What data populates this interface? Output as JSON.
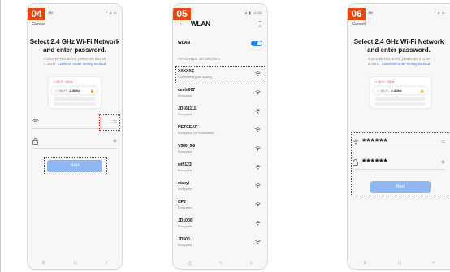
{
  "step1": {
    "badge": "04",
    "status_left": "AM",
    "status_right": "* ⊿ ▭",
    "cancel": "Cancel",
    "title_line1": "Select 2.4 GHz Wi-Fi Network",
    "title_line2": "and enter password.",
    "sub_line1": "If your Wi-Fi is 5GHz, please set it to be",
    "sub_prefix": "2.4GHz.",
    "sub_link": "Common router setting method",
    "card_row1": "× Wi-Fi - 5Ghz",
    "card_row2_prefix": "✓ Wi-Fi - ",
    "card_row2_bold": "2.4Ghz",
    "password_value": "",
    "next": "Next"
  },
  "step2": {
    "badge": "05",
    "status_right": "⊿ ▮ 11:02",
    "back": "←",
    "title": "WLAN",
    "more": "⋮",
    "toggle_label": "WLAN",
    "toggle_on": true,
    "available": "AVAILABLE NETWORKS",
    "networks": [
      {
        "name": "XXXXXX",
        "status": "Connected (good quality)"
      },
      {
        "name": "ceshi007",
        "status": "Encrypted"
      },
      {
        "name": "JD161111",
        "status": "Encrypted"
      },
      {
        "name": "NETGEAR",
        "status": "Encrypted (WPS available)"
      },
      {
        "name": "V380_5G",
        "status": "Encrypted"
      },
      {
        "name": "wifi123",
        "status": "Encrypted"
      },
      {
        "name": "xiaoyi",
        "status": "Encrypted"
      },
      {
        "name": "CP2",
        "status": "Encrypted"
      },
      {
        "name": "JD1000",
        "status": "Encrypted"
      },
      {
        "name": "JD500",
        "status": "Encrypted"
      }
    ]
  },
  "step3": {
    "badge": "06",
    "status_left": "AM",
    "status_right": "* ⊿ ▭",
    "cancel": "Cancel",
    "title_line1": "Select 2.4 GHz Wi-Fi Network",
    "title_line2": "and enter password.",
    "sub_line1": "If your Wi-Fi is 5GHz, please set it to be",
    "sub_prefix": "2.4GHz.",
    "sub_link": "Common router setting method",
    "card_row1": "× Wi-Fi - 5Ghz",
    "card_row2_prefix": "✓ Wi-Fi - ",
    "card_row2_bold": "2.4Ghz",
    "ssid_value": "******",
    "password_value": "******",
    "next": "Next"
  },
  "nav": {
    "menu": "≡",
    "home": "□",
    "back": "‹",
    "back2": "◁",
    "home2": "○"
  },
  "icons": {
    "wifi": "wifi-icon",
    "lock": "lock-icon",
    "eye": "eye-icon",
    "swap": "swap-icon",
    "signal": "wifi-signal-icon"
  },
  "colors": {
    "badge": "#e8460e",
    "accent": "#2f80ed",
    "highlight": "#d01a1a",
    "button": "#8fb7f2"
  }
}
